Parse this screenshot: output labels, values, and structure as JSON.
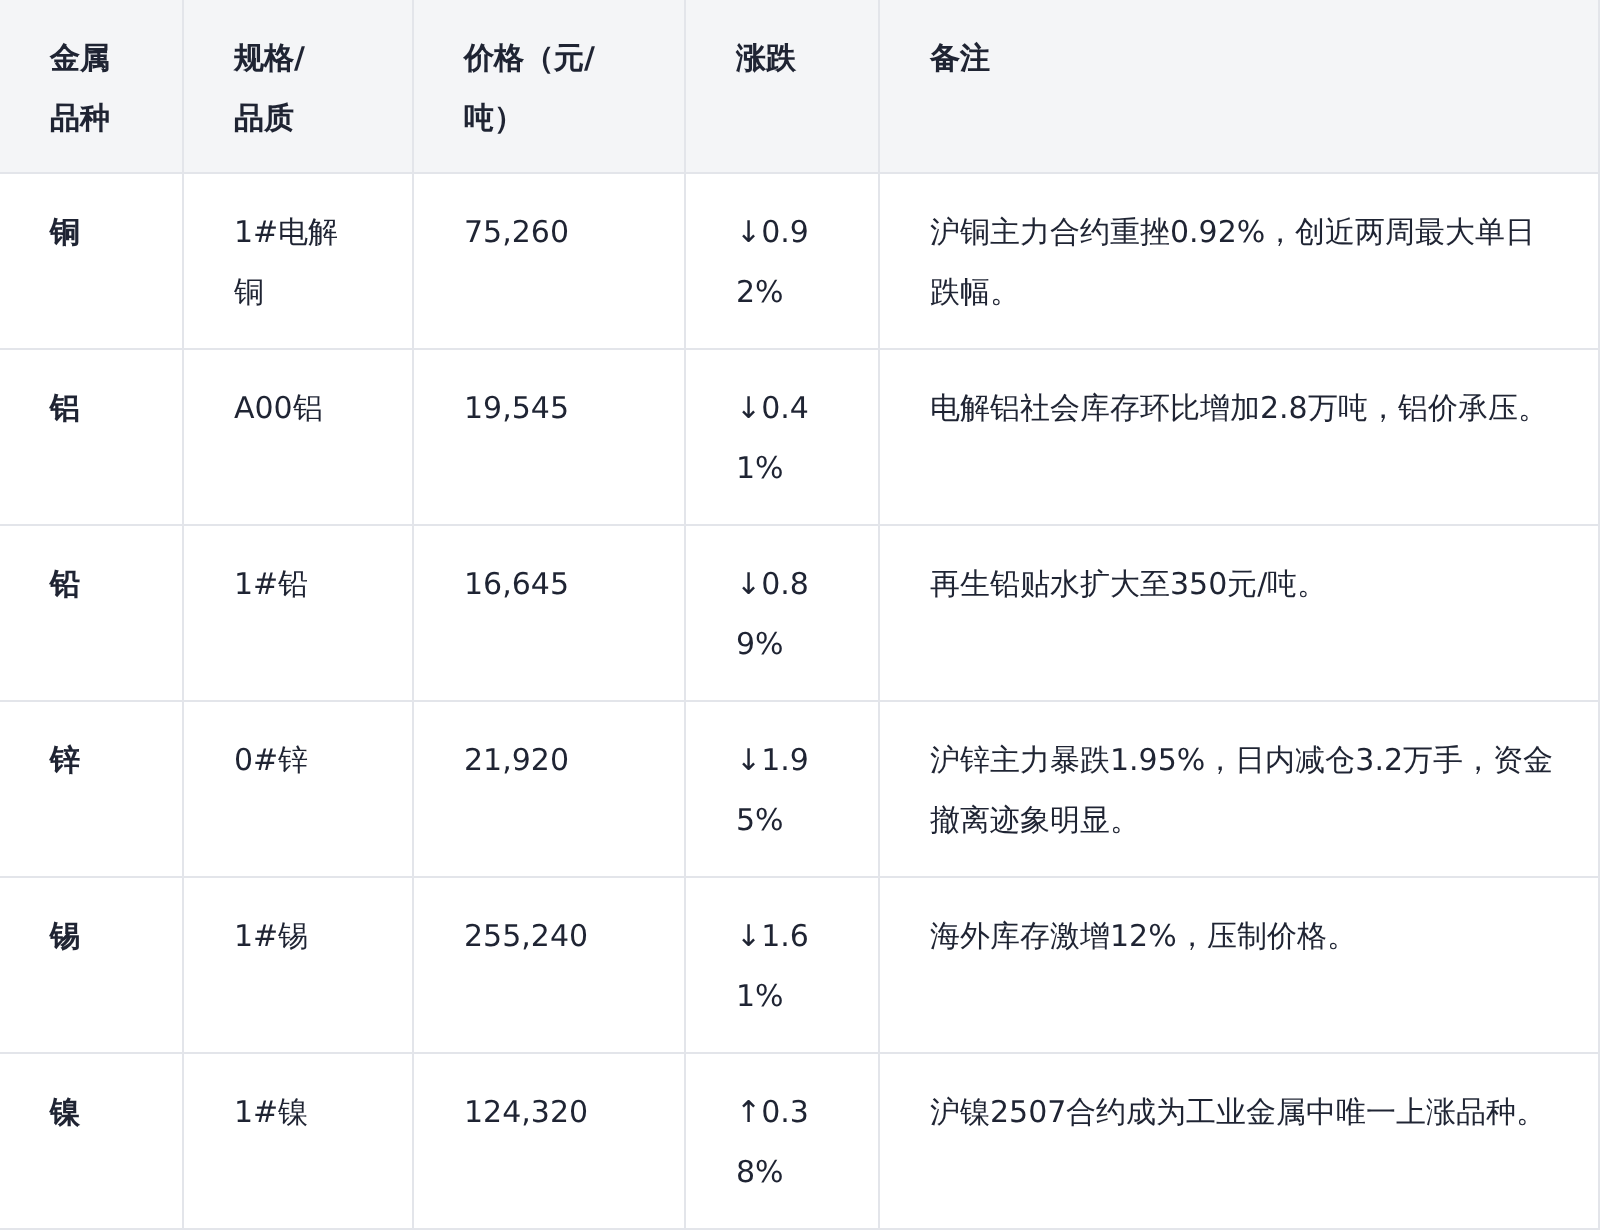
{
  "table": {
    "columns": [
      "金属品种",
      "规格/品质",
      "价格（元/吨）",
      "涨跌",
      "备注"
    ],
    "rows": [
      {
        "metal": "铜",
        "spec": "1#电解铜",
        "price": "75,260",
        "change": "↓0.92%",
        "note": "沪铜主力合约重挫0.92%，创近两周最大单日跌幅。"
      },
      {
        "metal": "铝",
        "spec": "A00铝",
        "price": "19,545",
        "change": "↓0.41%",
        "note": "电解铝社会库存环比增加2.8万吨，铝价承压。"
      },
      {
        "metal": "铅",
        "spec": "1#铅",
        "price": "16,645",
        "change": "↓0.89%",
        "note": "再生铅贴水扩大至350元/吨。"
      },
      {
        "metal": "锌",
        "spec": "0#锌",
        "price": "21,920",
        "change": "↓1.95%",
        "note": "沪锌主力暴跌1.95%，日内减仓3.2万手，资金撤离迹象明显。"
      },
      {
        "metal": "锡",
        "spec": "1#锡",
        "price": "255,240",
        "change": "↓1.61%",
        "note": "海外库存激增12%，压制价格。"
      },
      {
        "metal": "镍",
        "spec": "1#镍",
        "price": "124,320",
        "change": "↑0.38%",
        "note": "沪镍2507合约成为工业金属中唯一上涨品种。"
      }
    ]
  }
}
